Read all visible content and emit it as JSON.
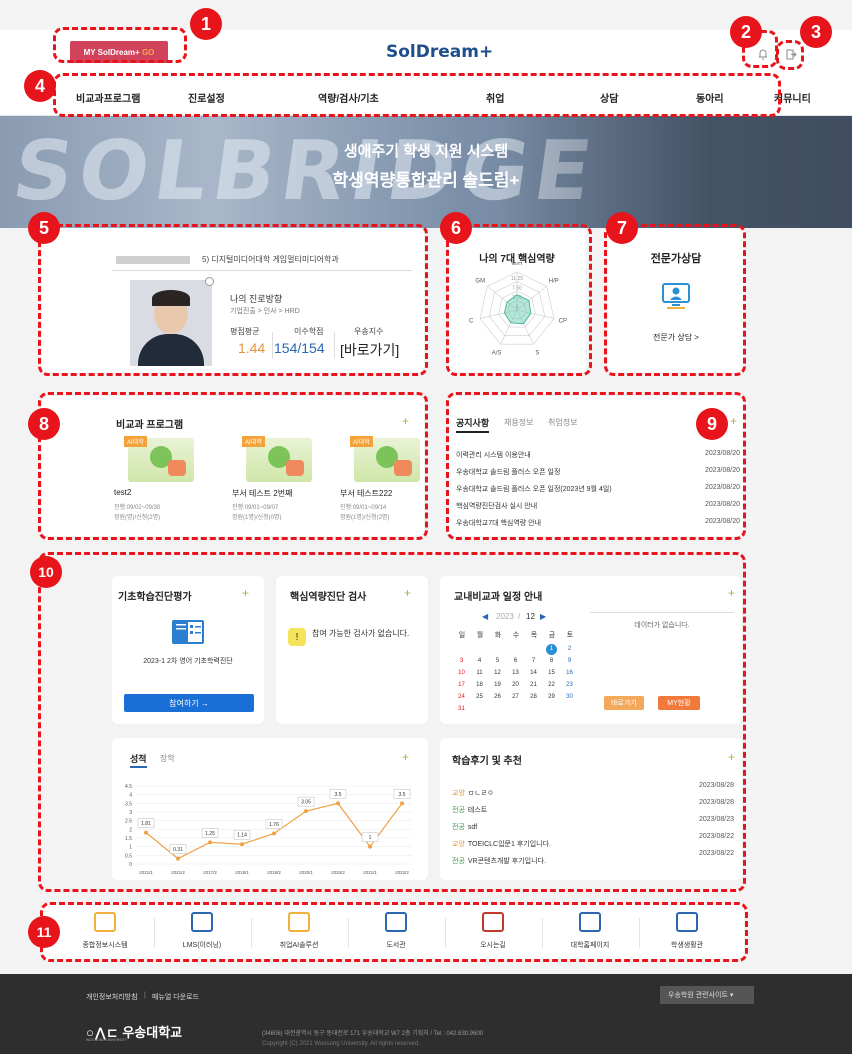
{
  "header": {
    "mysol_label": "MY SolDream+",
    "go_label": "GO",
    "logo": "SolDream+"
  },
  "nav": [
    "비교과프로그램",
    "진로설정",
    "역량/검사/기초",
    "취업",
    "상담",
    "동아리",
    "커뮤니티"
  ],
  "hero": {
    "line1": "생애주기 학생 지원 시스템",
    "line2": "학생역량통합관리 솔드림+",
    "bg_text": "SOLBRIDGE"
  },
  "profile": {
    "dept": "5) 디지털미디어대학 게임멀티미디어학과",
    "career_title": "나의 진로방향",
    "career_path": "기업진출 > 인사 > HRD",
    "gpa_label": "평점평균",
    "gpa": "1.44",
    "credit_label": "이수학점",
    "credit": "154/154",
    "excel_label": "우송지수",
    "excel_link": "[바로가기]"
  },
  "competency": {
    "title": "나의 7대 핵심역량",
    "axes": [
      "M/H",
      "H/P",
      "CP",
      "S",
      "A/S",
      "C",
      "GM"
    ],
    "ticks": [
      "11.25",
      "7.50",
      "3.75",
      "0"
    ],
    "values": [
      4.5,
      4.5,
      4.2,
      4.5,
      4.2,
      3.8,
      3.8
    ]
  },
  "expert": {
    "title": "전문가상담",
    "link": "전문가 상담 >"
  },
  "programs": {
    "title": "비교과 프로그램",
    "plus": "+",
    "items": [
      {
        "badge": "AI대학",
        "name": "test2",
        "period": "진행:09/02~09/30",
        "count": "정원(명)/신청(2명)"
      },
      {
        "badge": "AI대학",
        "name": "부서 테스트 2번째",
        "period": "진행:09/01~09/07",
        "count": "정원(1명)/신청(0명)"
      },
      {
        "badge": "AI대학",
        "name": "부서 테스트222",
        "period": "진행:09/01~09/14",
        "count": "정원(1명)/신청(2명)"
      }
    ]
  },
  "notices": {
    "tabs": [
      "공지사항",
      "채용정보",
      "취업정보"
    ],
    "plus": "+",
    "items": [
      {
        "title": "이력관리 시스템 이용안내",
        "date": "2023/08/20"
      },
      {
        "title": "우송대학교 솔드림 플러스 오픈 일정",
        "date": "2023/08/20"
      },
      {
        "title": "우송대학교 솔드림 플러스 오픈 일정(2023년 9월 4일)",
        "date": "2023/08/20"
      },
      {
        "title": "핵심역량진단검사 실시 안내",
        "date": "2023/08/20"
      },
      {
        "title": "우송대학교7대 핵심역량 안내",
        "date": "2023/08/20"
      }
    ]
  },
  "basic_eval": {
    "title": "기초학습진단평가",
    "plus": "+",
    "test": "2023-1 2차 영어 기초학력진단",
    "button": "참여하기 →"
  },
  "core_test": {
    "title": "핵심역량진단 검사",
    "plus": "+",
    "msg": "참여 가능한 검사가 없습니다."
  },
  "schedule": {
    "title": "교내비교과 일정 안내",
    "plus": "+",
    "year": "2023",
    "month": "12",
    "weekdays": [
      "일",
      "월",
      "화",
      "수",
      "목",
      "금",
      "토"
    ],
    "weeks": [
      [
        "",
        "",
        "",
        "",
        "",
        "1",
        "2"
      ],
      [
        "3",
        "4",
        "5",
        "6",
        "7",
        "8",
        "9"
      ],
      [
        "10",
        "11",
        "12",
        "13",
        "14",
        "15",
        "16"
      ],
      [
        "17",
        "18",
        "19",
        "20",
        "21",
        "22",
        "23"
      ],
      [
        "24",
        "25",
        "26",
        "27",
        "28",
        "29",
        "30"
      ],
      [
        "31",
        "",
        "",
        "",
        "",
        "",
        ""
      ]
    ],
    "empty": "데이터가 없습니다.",
    "btn1": "바로가기",
    "btn2": "MY현황"
  },
  "grades": {
    "tabs": [
      "성적",
      "장학"
    ],
    "plus": "+"
  },
  "reviews": {
    "title": "학습후기 및 추천",
    "plus": "+",
    "items": [
      {
        "tag": "교양",
        "title": "ㅁㄴㄹㅇ",
        "date": "2023/08/28"
      },
      {
        "tag": "전공",
        "title": "테스트",
        "date": "2023/08/28"
      },
      {
        "tag": "전공",
        "title": "sdf",
        "date": "2023/08/23"
      },
      {
        "tag": "교양",
        "title": "TOEICLC입문1 후기입니다.",
        "date": "2023/08/22"
      },
      {
        "tag": "전공",
        "title": "VR콘텐츠개발 후기입니다.",
        "date": "2023/08/22"
      }
    ]
  },
  "chart_data": {
    "type": "line",
    "categories": [
      "2021/1",
      "2021/2",
      "2017/2",
      "2018/1",
      "2018/2",
      "2020/1",
      "2020/2",
      "2021/1",
      "2022/2"
    ],
    "values": [
      1.81,
      0.31,
      1.25,
      1.14,
      1.76,
      3.05,
      3.5,
      1,
      3.5
    ],
    "ylim": [
      0,
      4.5
    ],
    "yticks": [
      "4.5",
      "4",
      "3.5",
      "3",
      "2.5",
      "2",
      "1.5",
      "1",
      "0.5",
      "0"
    ]
  },
  "quicklinks": [
    "종합정보시스템",
    "LMS(이러닝)",
    "취업AI솔루션",
    "도서관",
    "오시는길",
    "대학홈페이지",
    "학생생활관"
  ],
  "footer": {
    "privacy": "개인정보처리방침",
    "manual": "매뉴얼 다운로드",
    "related": "우송학원 관련사이트",
    "univ": "우송대학교",
    "univ_en": "WOOSONG UNIVERSITY",
    "address": "(34606) 대전광역시 동구 동대전로 171 우송대학교 W7 2층 기획처 / Tel : 042.630.9600",
    "copyright": "Copyright (C) 2021 Woosong University. All rights reserved."
  },
  "markers": [
    "1",
    "2",
    "3",
    "4",
    "5",
    "6",
    "7",
    "8",
    "9",
    "10",
    "11"
  ]
}
